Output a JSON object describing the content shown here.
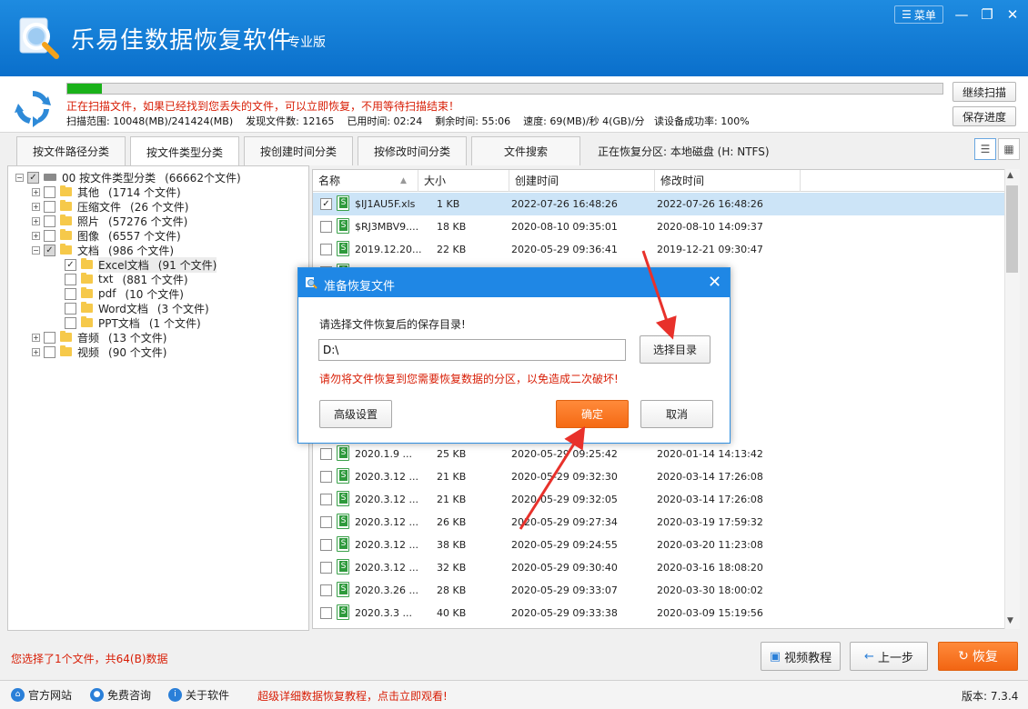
{
  "app": {
    "title": "乐易佳数据恢复软件",
    "edition": "专业版",
    "menu_label": "菜单",
    "window_controls": [
      "minimize-icon",
      "restore-icon",
      "close-icon"
    ]
  },
  "scan": {
    "progress_percent": 4,
    "message": "正在扫描文件，如果已经找到您丢失的文件，可以立即恢复，不用等待扫描结束！",
    "range_label": "扫描范围: 10048(MB)/241424(MB)",
    "found_label": "发现文件数: 12165",
    "elapsed_label": "已用时间: 02:24",
    "remaining_label": "剩余时间: 55:06",
    "speed_label": "速度: 69(MB)/秒  4(GB)/分",
    "success_label": "读设备成功率: 100%",
    "continue_button": "继续扫描",
    "save_button": "保存进度"
  },
  "tabs": [
    {
      "label": "按文件路径分类",
      "active": false
    },
    {
      "label": "按文件类型分类",
      "active": true
    },
    {
      "label": "按创建时间分类",
      "active": false
    },
    {
      "label": "按修改时间分类",
      "active": false
    },
    {
      "label": "文件搜索",
      "active": false
    }
  ],
  "partition_label": "正在恢复分区: 本地磁盘 (H: NTFS)",
  "tree": {
    "root": {
      "name": "00  按文件类型分类",
      "count": "(66662个文件)"
    },
    "items": [
      {
        "name": "其他",
        "count": "(1714 个文件)"
      },
      {
        "name": "压缩文件",
        "count": "(26 个文件)"
      },
      {
        "name": "照片",
        "count": "(57276 个文件)"
      },
      {
        "name": "图像",
        "count": "(6557 个文件)"
      },
      {
        "name": "文档",
        "count": "(986 个文件)"
      },
      {
        "name": "Excel文档",
        "count": "(91 个文件)"
      },
      {
        "name": "txt",
        "count": "(881 个文件)"
      },
      {
        "name": "pdf",
        "count": "(10 个文件)"
      },
      {
        "name": "Word文档",
        "count": "(3 个文件)"
      },
      {
        "name": "PPT文档",
        "count": "(1 个文件)"
      },
      {
        "name": "音频",
        "count": "(13 个文件)"
      },
      {
        "name": "视频",
        "count": "(90 个文件)"
      }
    ]
  },
  "filelist": {
    "columns": [
      "名称",
      "大小",
      "创建时间",
      "修改时间"
    ],
    "rows": [
      {
        "name": "$IJ1AU5F.xls",
        "size": "1 KB",
        "created": "2022-07-26  16:48:26",
        "modified": "2022-07-26  16:48:26",
        "checked": true
      },
      {
        "name": "$RJ3MBV9....",
        "size": "18 KB",
        "created": "2020-08-10  09:35:01",
        "modified": "2020-08-10  14:09:37",
        "checked": false
      },
      {
        "name": "2019.12.20...",
        "size": "22 KB",
        "created": "2020-05-29  09:36:41",
        "modified": "2019-12-21  09:30:47",
        "checked": false
      },
      {
        "name": "",
        "size": "",
        "created": "",
        "modified": "38:01",
        "checked": false
      },
      {
        "name": "",
        "size": "",
        "created": "",
        "modified": "35:16",
        "checked": false
      },
      {
        "name": "",
        "size": "",
        "created": "",
        "modified": "27:29",
        "checked": false
      },
      {
        "name": "",
        "size": "",
        "created": "",
        "modified": "31:57",
        "checked": false
      },
      {
        "name": "",
        "size": "",
        "created": "",
        "modified": "31:28",
        "checked": false
      },
      {
        "name": "",
        "size": "",
        "created": "",
        "modified": "55:30",
        "checked": false
      },
      {
        "name": "",
        "size": "",
        "created": "",
        "modified": "07:16",
        "checked": false
      },
      {
        "name": "",
        "size": "",
        "created": "",
        "modified": "00:05",
        "checked": false
      },
      {
        "name": "2020.1.9 ...",
        "size": "25 KB",
        "created": "2020-05-29  09:25:42",
        "modified": "2020-01-14  14:13:42",
        "checked": false
      },
      {
        "name": "2020.3.12 ...",
        "size": "21 KB",
        "created": "2020-05-29  09:32:30",
        "modified": "2020-03-14  17:26:08",
        "checked": false
      },
      {
        "name": "2020.3.12 ...",
        "size": "21 KB",
        "created": "2020-05-29  09:32:05",
        "modified": "2020-03-14  17:26:08",
        "checked": false
      },
      {
        "name": "2020.3.12 ...",
        "size": "26 KB",
        "created": "2020-05-29  09:27:34",
        "modified": "2020-03-19  17:59:32",
        "checked": false
      },
      {
        "name": "2020.3.12 ...",
        "size": "38 KB",
        "created": "2020-05-29  09:24:55",
        "modified": "2020-03-20  11:23:08",
        "checked": false
      },
      {
        "name": "2020.3.12 ...",
        "size": "32 KB",
        "created": "2020-05-29  09:30:40",
        "modified": "2020-03-16  18:08:20",
        "checked": false
      },
      {
        "name": "2020.3.26 ...",
        "size": "28 KB",
        "created": "2020-05-29  09:33:07",
        "modified": "2020-03-30  18:00:02",
        "checked": false
      },
      {
        "name": "2020.3.3 ...",
        "size": "40 KB",
        "created": "2020-05-29  09:33:38",
        "modified": "2020-03-09  15:19:56",
        "checked": false
      }
    ]
  },
  "dialog": {
    "title": "准备恢复文件",
    "prompt": "请选择文件恢复后的保存目录!",
    "path_value": "D:\\",
    "choose_button": "选择目录",
    "warning": "请勿将文件恢复到您需要恢复数据的分区，以免造成二次破坏!",
    "advanced_button": "高级设置",
    "ok_button": "确定",
    "cancel_button": "取消"
  },
  "status": {
    "selection": "您选择了1个文件，共64(B)数据"
  },
  "bottom_buttons": {
    "video": "视频教程",
    "prev": "上一步",
    "recover": "恢复"
  },
  "footer": {
    "site": "官方网站",
    "consult": "免费咨询",
    "about": "关于软件",
    "promo": "超级详细数据恢复教程，点击立即观看!",
    "version": "版本: 7.3.4"
  },
  "colors": {
    "brand_blue": "#1f87e5",
    "warning_red": "#d81e06",
    "accent_orange": "#f56a14",
    "progress_green": "#1ab11a"
  }
}
